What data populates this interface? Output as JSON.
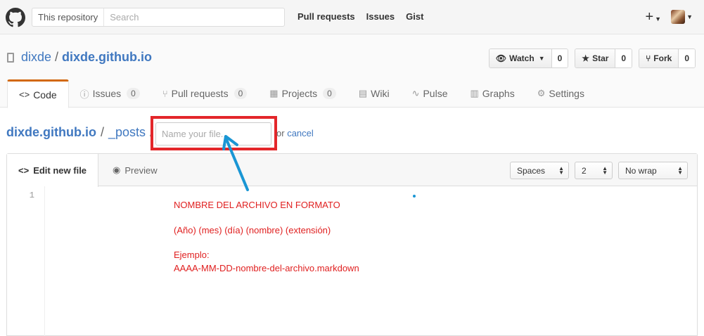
{
  "header": {
    "search_scope": "This repository",
    "search_placeholder": "Search",
    "nav": [
      "Pull requests",
      "Issues",
      "Gist"
    ]
  },
  "repo": {
    "owner": "dixde",
    "separator": "/",
    "name": "dixde.github.io",
    "watch": {
      "label": "Watch",
      "count": "0"
    },
    "star": {
      "label": "Star",
      "count": "0"
    },
    "fork": {
      "label": "Fork",
      "count": "0"
    }
  },
  "tabs": [
    {
      "label": "Code",
      "icon": "code-icon",
      "count": null
    },
    {
      "label": "Issues",
      "icon": "issue-icon",
      "count": "0"
    },
    {
      "label": "Pull requests",
      "icon": "pr-icon",
      "count": "0"
    },
    {
      "label": "Projects",
      "icon": "project-icon",
      "count": "0"
    },
    {
      "label": "Wiki",
      "icon": "book-icon",
      "count": null
    },
    {
      "label": "Pulse",
      "icon": "pulse-icon",
      "count": null
    },
    {
      "label": "Graphs",
      "icon": "graph-icon",
      "count": null
    },
    {
      "label": "Settings",
      "icon": "gear-icon",
      "count": null
    }
  ],
  "breadcrumb": {
    "root": "dixde.github.io",
    "sep": "/",
    "dir": "_posts",
    "sep2": "/",
    "filename_placeholder": "Name your file...",
    "or_text": "or",
    "cancel": "cancel"
  },
  "editor": {
    "tab_edit": "Edit new file",
    "tab_preview": "Preview",
    "indent_mode": "Spaces",
    "indent_size": "2",
    "wrap_mode": "No wrap",
    "line_number": "1"
  },
  "annotation": {
    "line1": "NOMBRE DEL ARCHIVO EN FORMATO",
    "line2": "(Año) (mes) (día) (nombre) (extensión)",
    "line3": "Ejemplo:",
    "line4": "AAAA-MM-DD-nombre-del-archivo.markdown",
    "highlight_color": "#e3262a",
    "arrow_color": "#1a96d4"
  }
}
